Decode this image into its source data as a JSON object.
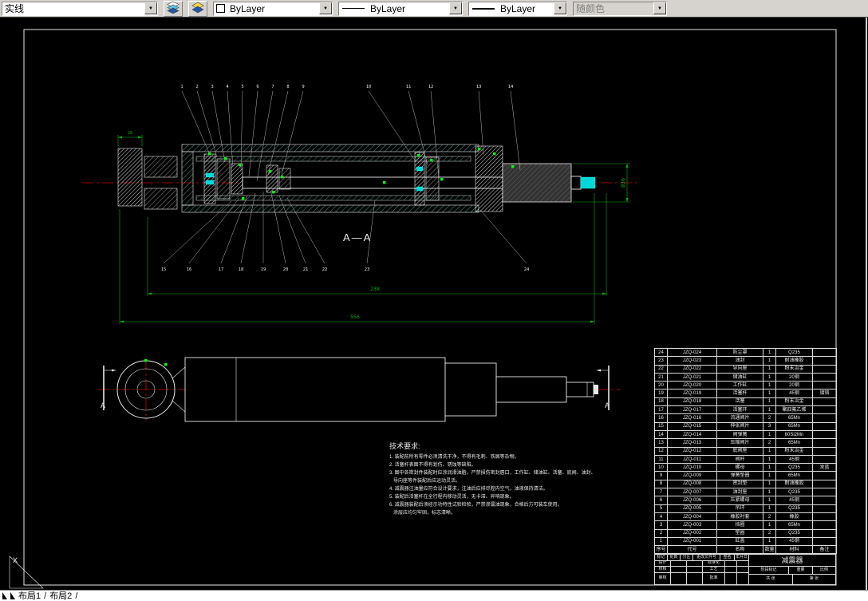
{
  "toolbar": {
    "linetype_value": "实线",
    "color_value": "ByLayer",
    "linetype2_value": "ByLayer",
    "lineweight_value": "ByLayer",
    "plotstyle_value": "随颜色"
  },
  "colors": {
    "dim": "#00b400",
    "grip": "#00ff00",
    "center": "#d40000",
    "cyan": "#00d8d8",
    "hatch": "#43a08c"
  },
  "drawing": {
    "section_label": "A—A",
    "cut_label_left": "A",
    "cut_label_right": "A",
    "dim_overall": "238",
    "dim_total": "556",
    "dim_eye_width": "28",
    "dim_rod_dia": "Ø36",
    "top_callouts": [
      "1",
      "2",
      "3",
      "4",
      "5",
      "6",
      "7",
      "8",
      "9",
      "10",
      "11",
      "12",
      "13",
      "14"
    ],
    "bottom_callouts": [
      "15",
      "16",
      "17",
      "18",
      "19",
      "20",
      "21",
      "22",
      "23",
      "24"
    ]
  },
  "tech_notes": {
    "title": "技术要求:",
    "lines": [
      "1. 装配前所有零件必须清洗干净，不得有毛刺、铁屑等杂物。",
      "2. 活塞杆表面不得有划伤、锈蚀等缺陷。",
      "3. 图中各密封件装配时应涂润滑油脂，严禁损伤密封唇口，工作缸、储油缸、活塞、底阀、油封、",
      "   导向座等件装配后应运动灵活。",
      "4. 减震器注油量应符合设计要求，注油后应排尽腔内空气，油液保持清洁。",
      "5. 装配后活塞杆在全行程内移动灵活，无卡滞、异响现象。",
      "6. 减震器装配后须经示功特性试验检验，严禁渗漏油现象，合格后方可装车使用，",
      "   涂层应均匀牢固，标志清晰。"
    ]
  },
  "parts_table": {
    "headers": [
      "序号",
      "代号",
      "名称",
      "数量",
      "材料",
      "备注"
    ],
    "rows": [
      {
        "no": "24",
        "code": "JZQ-024",
        "name": "防尘罩",
        "qty": "1",
        "mat": "Q235",
        "note": ""
      },
      {
        "no": "23",
        "code": "JZQ-023",
        "name": "油封",
        "qty": "1",
        "mat": "耐油橡胶",
        "note": ""
      },
      {
        "no": "22",
        "code": "JZQ-022",
        "name": "导向座",
        "qty": "1",
        "mat": "粉末冶金",
        "note": ""
      },
      {
        "no": "21",
        "code": "JZQ-021",
        "name": "储油缸",
        "qty": "1",
        "mat": "20钢",
        "note": ""
      },
      {
        "no": "20",
        "code": "JZQ-020",
        "name": "工作缸",
        "qty": "1",
        "mat": "20钢",
        "note": ""
      },
      {
        "no": "19",
        "code": "JZQ-019",
        "name": "活塞杆",
        "qty": "1",
        "mat": "45钢",
        "note": "镀铬"
      },
      {
        "no": "18",
        "code": "JZQ-018",
        "name": "活塞",
        "qty": "1",
        "mat": "粉末冶金",
        "note": ""
      },
      {
        "no": "17",
        "code": "JZQ-017",
        "name": "活塞环",
        "qty": "1",
        "mat": "聚四氟乙烯",
        "note": ""
      },
      {
        "no": "16",
        "code": "JZQ-016",
        "name": "流通阀片",
        "qty": "2",
        "mat": "65Mn",
        "note": ""
      },
      {
        "no": "15",
        "code": "JZQ-015",
        "name": "伸张阀片",
        "qty": "3",
        "mat": "65Mn",
        "note": ""
      },
      {
        "no": "14",
        "code": "JZQ-014",
        "name": "阀弹簧",
        "qty": "1",
        "mat": "60Si2Mn",
        "note": ""
      },
      {
        "no": "13",
        "code": "JZQ-013",
        "name": "压缩阀片",
        "qty": "2",
        "mat": "65Mn",
        "note": ""
      },
      {
        "no": "12",
        "code": "JZQ-012",
        "name": "底阀座",
        "qty": "1",
        "mat": "粉末冶金",
        "note": ""
      },
      {
        "no": "11",
        "code": "JZQ-011",
        "name": "阀杆",
        "qty": "1",
        "mat": "45钢",
        "note": ""
      },
      {
        "no": "10",
        "code": "JZQ-010",
        "name": "螺母",
        "qty": "1",
        "mat": "Q235",
        "note": "发蓝"
      },
      {
        "no": "9",
        "code": "JZQ-009",
        "name": "弹簧垫圈",
        "qty": "1",
        "mat": "65Mn",
        "note": ""
      },
      {
        "no": "8",
        "code": "JZQ-008",
        "name": "密封垫",
        "qty": "1",
        "mat": "耐油橡胶",
        "note": ""
      },
      {
        "no": "7",
        "code": "JZQ-007",
        "name": "油封座",
        "qty": "1",
        "mat": "Q235",
        "note": ""
      },
      {
        "no": "6",
        "code": "JZQ-006",
        "name": "压紧螺母",
        "qty": "1",
        "mat": "45钢",
        "note": ""
      },
      {
        "no": "5",
        "code": "JZQ-005",
        "name": "吊环",
        "qty": "1",
        "mat": "Q235",
        "note": ""
      },
      {
        "no": "4",
        "code": "JZQ-004",
        "name": "橡胶衬套",
        "qty": "2",
        "mat": "橡胶",
        "note": ""
      },
      {
        "no": "3",
        "code": "JZQ-003",
        "name": "挡圈",
        "qty": "1",
        "mat": "65Mn",
        "note": ""
      },
      {
        "no": "2",
        "code": "JZQ-002",
        "name": "垫圈",
        "qty": "2",
        "mat": "Q235",
        "note": ""
      },
      {
        "no": "1",
        "code": "JZQ-001",
        "name": "缸盖",
        "qty": "1",
        "mat": "45钢",
        "note": ""
      }
    ]
  },
  "title_block": {
    "mark": "标记",
    "count": "处数",
    "zone": "分区",
    "change_file": "更改文件号",
    "sign": "签名",
    "date": "年月日",
    "design": "设计",
    "standardize": "标准化",
    "check": "校核",
    "process": "工艺",
    "review": "审核",
    "approve": "批准",
    "stage": "阶段标记",
    "weight": "重量",
    "scale": "比例",
    "sheets_total": "共 张",
    "sheet_no": "第 张",
    "part_name": "减震器"
  },
  "tabs": {
    "tab1": "布局1",
    "tab2": "布局2",
    "sep": "/"
  },
  "ucs_label": "X"
}
